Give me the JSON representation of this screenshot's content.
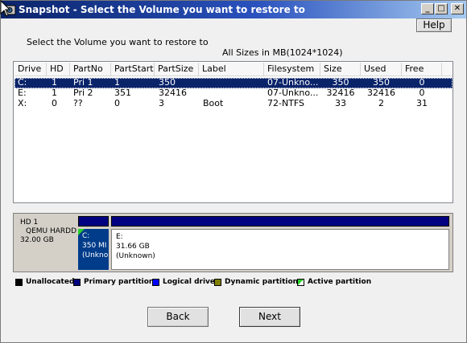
{
  "window": {
    "title": "Snapshot - Select the Volume you want to restore to",
    "help_label": "Help",
    "min_symbol": "_",
    "max_symbol": "□",
    "close_symbol": "✕"
  },
  "instruction": "Select the Volume you want to restore to",
  "sizes_note": "All Sizes in MB(1024*1024)",
  "columns": [
    "Drive",
    "HD",
    "PartNo",
    "PartStart",
    "PartSize",
    "Label",
    "Filesystem",
    "Size",
    "Used",
    "Free"
  ],
  "rows": [
    {
      "selected": true,
      "cells": [
        "C:",
        "1",
        "Pri  1",
        "1",
        "350",
        "",
        "07-Unkno...",
        "350",
        "350",
        "0"
      ]
    },
    {
      "selected": false,
      "cells": [
        "E:",
        "1",
        "Pri  2",
        "351",
        "32416",
        "",
        "07-Unkno...",
        "32416",
        "32416",
        "0"
      ]
    },
    {
      "selected": false,
      "cells": [
        "X:",
        "0",
        "??",
        "0",
        "3",
        "Boot",
        "72-NTFS",
        "33",
        "2",
        "31"
      ]
    }
  ],
  "disk_map": {
    "disk": {
      "line1": "HD  1",
      "line2": "QEMU  HARDD",
      "line3": "32.00  GB"
    },
    "partitions": [
      {
        "line1": "C:",
        "line2": "350  MI",
        "line3": "(Unkno"
      },
      {
        "line1": "E:",
        "line2": "31.66  GB",
        "line3": "(Unknown)"
      }
    ]
  },
  "legend": [
    {
      "label": "Unallocated",
      "color": "#000000"
    },
    {
      "label": "Primary  partition",
      "color": "#000080"
    },
    {
      "label": "Logical  drive",
      "color": "#0000ff"
    },
    {
      "label": "Dynamic  partition",
      "color": "#808000"
    },
    {
      "label": "Active  partition",
      "color": "#2ad12a"
    }
  ],
  "buttons": {
    "back": "Back",
    "next": "Next"
  }
}
